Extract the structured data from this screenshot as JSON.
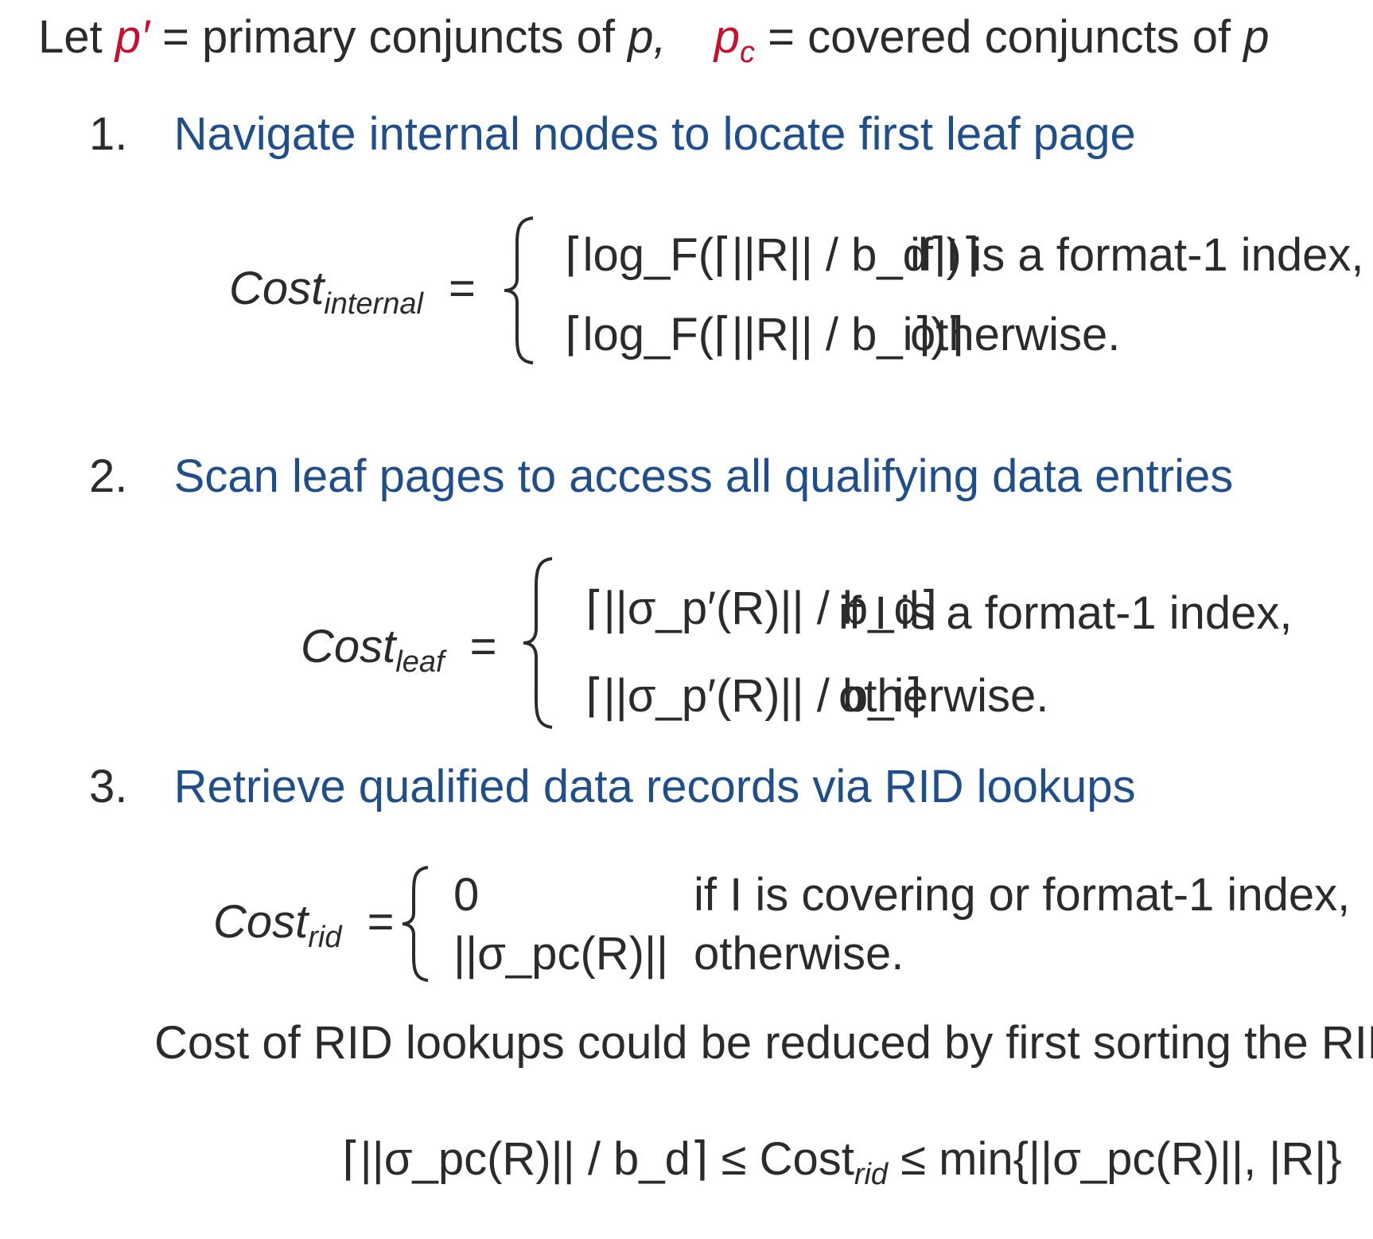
{
  "intro": {
    "let": "Let",
    "p_prime": "p′",
    "eq1": "= primary conjuncts of",
    "p1": "p,",
    "pc": "p",
    "pc_sub": "c",
    "eq2": "= covered conjuncts of",
    "p2": "p"
  },
  "steps": [
    {
      "num": "1.",
      "title": "Navigate internal nodes to locate first leaf page"
    },
    {
      "num": "2.",
      "title": "Scan leaf pages to access all qualifying data entries"
    },
    {
      "num": "3.",
      "title": "Retrieve qualified data records via RID lookups"
    }
  ],
  "formula_internal": {
    "cost": "Cost",
    "sub": "internal",
    "eq": "=",
    "case1_expr": "⌈log_F(⌈||R|| / b_d⌉)⌉",
    "case1_cond": "if I is a format-1 index,",
    "case2_expr": "⌈log_F(⌈||R|| / b_i⌉)⌉",
    "case2_cond": "otherwise."
  },
  "formula_leaf": {
    "cost": "Cost",
    "sub": "leaf",
    "eq": "=",
    "case1_expr": "⌈||σ_p′(R)|| / b_d⌉",
    "case1_cond": "if I is a format-1 index,",
    "case2_expr": "⌈||σ_p′(R)|| / b_i⌉",
    "case2_cond": "otherwise."
  },
  "formula_rid": {
    "cost": "Cost",
    "sub": "rid",
    "eq": "=",
    "case1_expr": "0",
    "case1_cond": "if I is covering or format-1 index,",
    "case2_expr": "||σ_pc(R)||",
    "case2_cond": "otherwise."
  },
  "note": "Cost of RID lookups could be reduced by first sorting the RIDs",
  "bound": {
    "lower": "⌈||σ_pc(R)|| / b_d⌉",
    "le1": "≤",
    "cost": "Cost",
    "sub": "rid",
    "le2": "≤",
    "upper": "min{||σ_pc(R)||, |R|}"
  }
}
